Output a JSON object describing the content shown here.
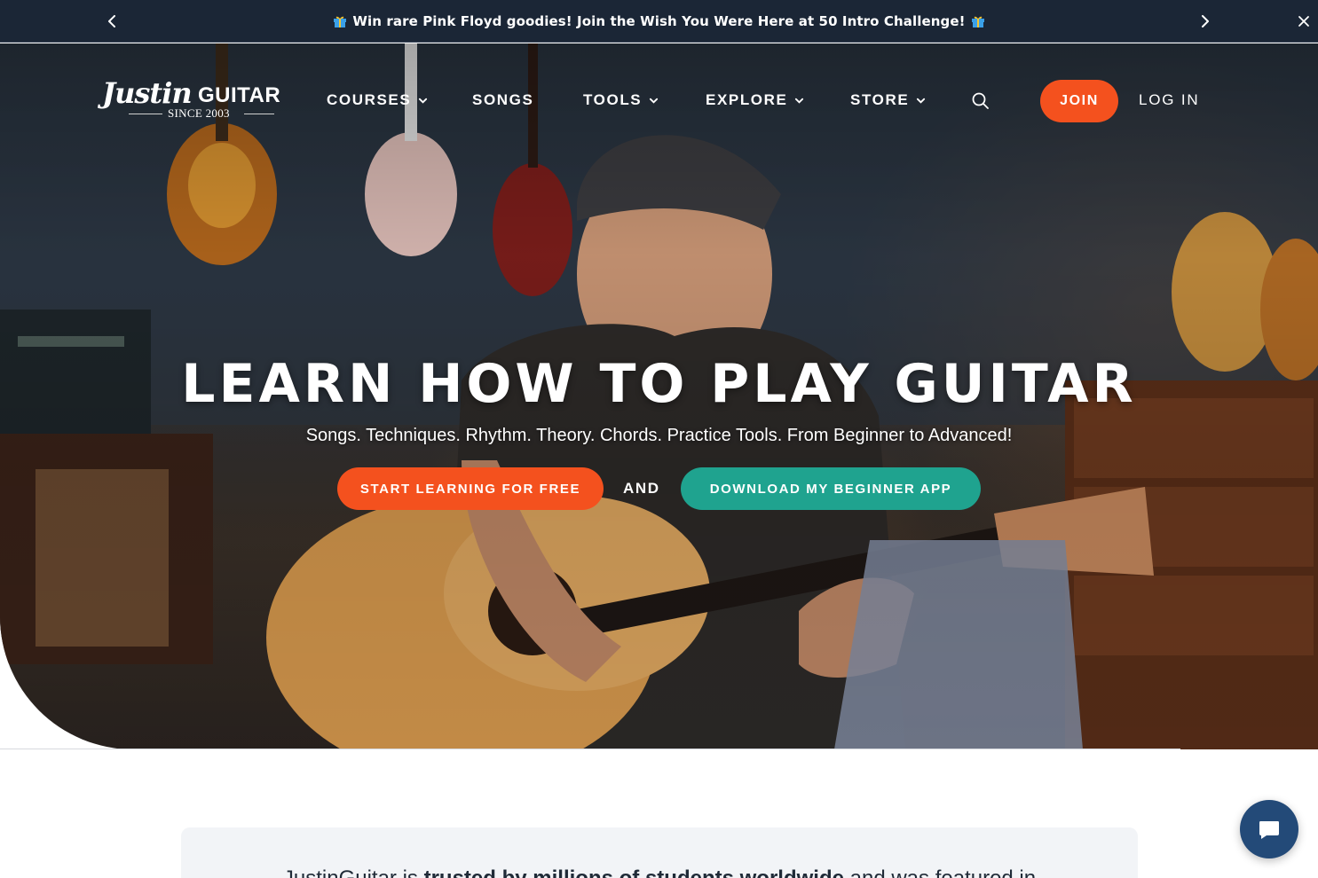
{
  "announcement": {
    "text": "Win rare Pink Floyd goodies! Join the Wish You Were Here at 50 Intro Challenge!",
    "gift_icon": "gift-icon",
    "prev_icon": "chevron-left-icon",
    "next_icon": "chevron-right-icon",
    "close_icon": "close-icon"
  },
  "logo": {
    "main": "Justin",
    "guitar": "GUITAR",
    "since": "SINCE 2003"
  },
  "nav": {
    "courses": "COURSES",
    "songs": "SONGS",
    "tools": "TOOLS",
    "explore": "EXPLORE",
    "store": "STORE",
    "search_icon": "search-icon",
    "join": "JOIN",
    "login": "LOG IN"
  },
  "hero": {
    "title": "LEARN HOW TO PLAY GUITAR",
    "subtitle": "Songs. Techniques. Rhythm. Theory. Chords. Practice Tools. From Beginner to Advanced!",
    "cta_start": "START LEARNING FOR FREE",
    "cta_and": "AND",
    "cta_app": "DOWNLOAD MY BEGINNER APP"
  },
  "trust": {
    "prefix": "JustinGuitar is ",
    "bold": "trusted by millions of students worldwide",
    "suffix": " and was featured in"
  },
  "colors": {
    "brand_orange": "#f4511e",
    "brand_teal": "#1fa38f",
    "announce_bg": "#1b2636",
    "chat_blue": "#234a78"
  },
  "chat": {
    "icon": "chat-icon"
  }
}
